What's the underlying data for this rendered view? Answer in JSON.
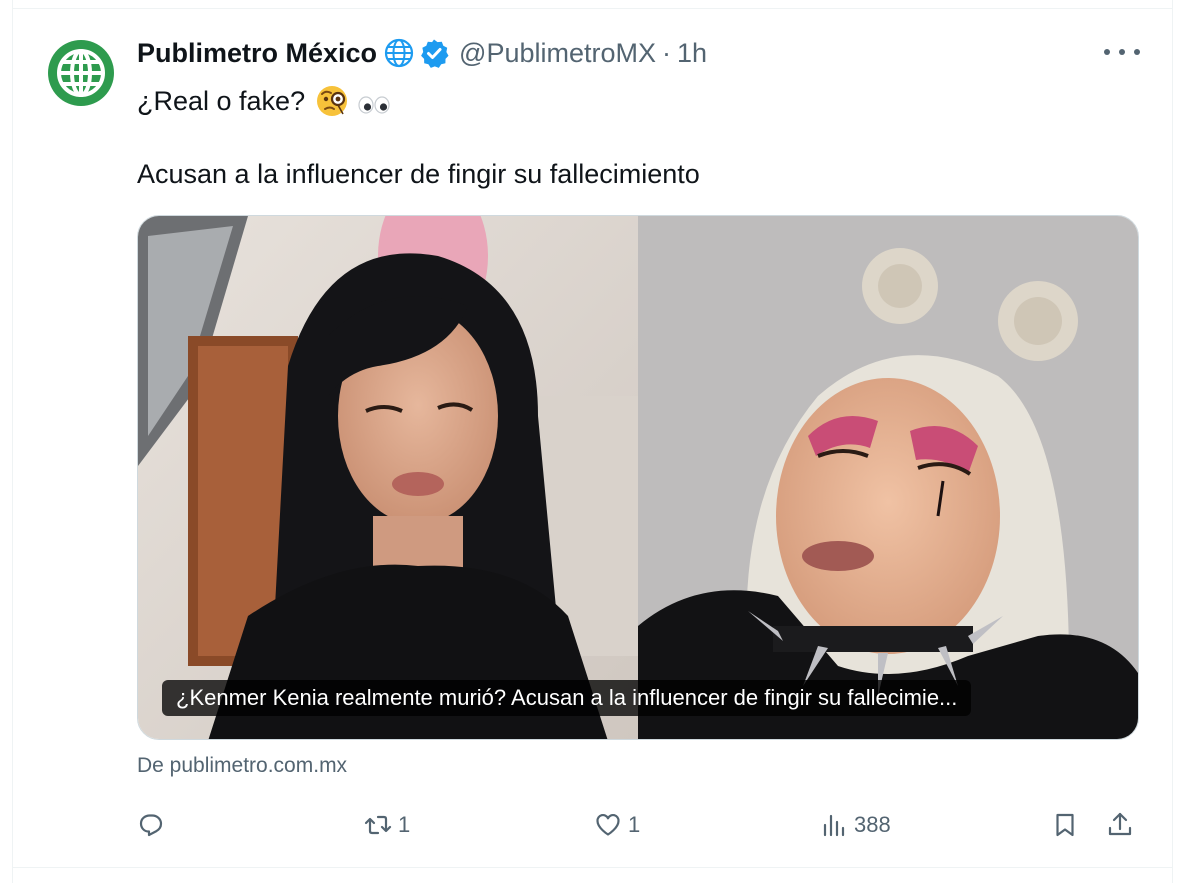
{
  "tweet": {
    "author_name": "Publimetro México",
    "handle": "@PublimetroMX",
    "separator": "·",
    "time": "1h",
    "text_line1": "¿Real o fake?",
    "text_line2": "Acusan a la influencer de fingir su fallecimiento",
    "emojis": [
      "monocle-face",
      "eyes"
    ]
  },
  "card": {
    "caption": "¿Kenmer Kenia realmente murió? Acusan a la influencer de fingir su fallecimie...",
    "source": "De publimetro.com.mx"
  },
  "actions": {
    "reply_count": "",
    "retweet_count": "1",
    "like_count": "1",
    "views_count": "388"
  },
  "colors": {
    "avatar_green": "#2e9b4e",
    "verified_blue": "#1d9bf0",
    "secondary_text": "#536471",
    "primary_text": "#0f1419",
    "border": "#eff3f4"
  },
  "icons": [
    "globe-icon",
    "verified-badge-icon",
    "more-icon",
    "reply-icon",
    "retweet-icon",
    "like-icon",
    "views-icon",
    "bookmark-icon",
    "share-icon"
  ]
}
